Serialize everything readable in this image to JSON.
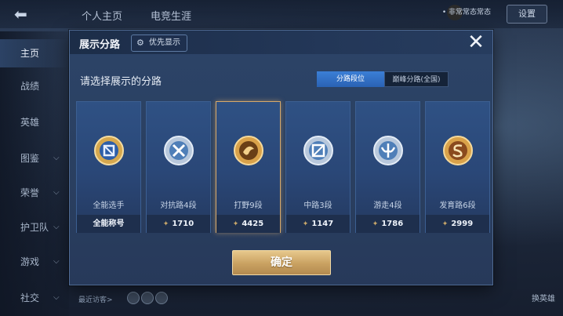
{
  "background": {
    "top_tabs": [
      "个人主页",
      "电竞生涯"
    ],
    "settings_label": "设置",
    "notification": "• 非常常态常态",
    "sidebar": [
      {
        "label": "主页",
        "active": true,
        "chevron": false
      },
      {
        "label": "战绩",
        "active": false,
        "chevron": false
      },
      {
        "label": "英雄",
        "active": false,
        "chevron": false
      },
      {
        "label": "图鉴",
        "active": false,
        "chevron": true
      },
      {
        "label": "荣誉",
        "active": false,
        "chevron": true
      },
      {
        "label": "护卫队",
        "active": false,
        "chevron": true
      },
      {
        "label": "游戏",
        "active": false,
        "chevron": true
      },
      {
        "label": "社交",
        "active": false,
        "chevron": true
      }
    ],
    "recent_visitors": "最近访客>",
    "swap_hero": "换英雄"
  },
  "modal": {
    "title": "展示分路",
    "priority_label": "优先显示",
    "close_symbol": "✕",
    "prompt": "请选择展示的分路",
    "tabs": [
      {
        "label": "分路段位",
        "active": true
      },
      {
        "label": "巅峰分路(全国)",
        "active": false
      }
    ],
    "cards": [
      {
        "role": "全能选手",
        "footer": "全能称号",
        "badge": "all-round-badge",
        "selected": false,
        "badge_color": "#d6a84e",
        "has_gem": false
      },
      {
        "role": "对抗路4段",
        "footer": "1710",
        "badge": "clash-lane-badge",
        "selected": false,
        "badge_color": "#b8c8dc",
        "has_gem": true
      },
      {
        "role": "打野9段",
        "footer": "4425",
        "badge": "jungle-badge",
        "selected": true,
        "badge_color": "#d9a24a",
        "has_gem": true
      },
      {
        "role": "中路3段",
        "footer": "1147",
        "badge": "mid-lane-badge",
        "selected": false,
        "badge_color": "#b8c8dc",
        "has_gem": true
      },
      {
        "role": "游走4段",
        "footer": "1786",
        "badge": "roam-badge",
        "selected": false,
        "badge_color": "#b8c8dc",
        "has_gem": true
      },
      {
        "role": "发育路6段",
        "footer": "2999",
        "badge": "farm-lane-badge",
        "selected": false,
        "badge_color": "#d9a24a",
        "has_gem": true
      }
    ],
    "confirm_label": "确定"
  },
  "colors": {
    "accent_blue": "#3b7fd6",
    "gold": "#c9a161",
    "modal_bg": "#2c4468"
  }
}
